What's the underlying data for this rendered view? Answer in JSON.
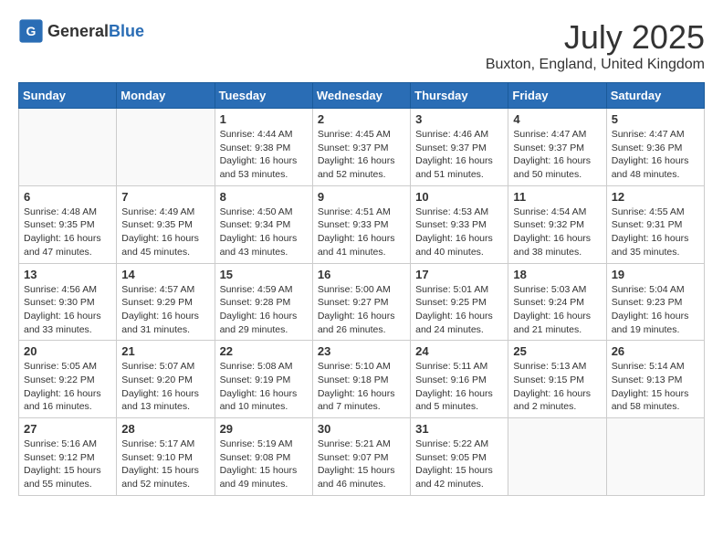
{
  "header": {
    "logo_general": "General",
    "logo_blue": "Blue",
    "month_year": "July 2025",
    "location": "Buxton, England, United Kingdom"
  },
  "days_of_week": [
    "Sunday",
    "Monday",
    "Tuesday",
    "Wednesday",
    "Thursday",
    "Friday",
    "Saturday"
  ],
  "weeks": [
    [
      {
        "day": "",
        "sunrise": "",
        "sunset": "",
        "daylight": ""
      },
      {
        "day": "",
        "sunrise": "",
        "sunset": "",
        "daylight": ""
      },
      {
        "day": "1",
        "sunrise": "Sunrise: 4:44 AM",
        "sunset": "Sunset: 9:38 PM",
        "daylight": "Daylight: 16 hours and 53 minutes."
      },
      {
        "day": "2",
        "sunrise": "Sunrise: 4:45 AM",
        "sunset": "Sunset: 9:37 PM",
        "daylight": "Daylight: 16 hours and 52 minutes."
      },
      {
        "day": "3",
        "sunrise": "Sunrise: 4:46 AM",
        "sunset": "Sunset: 9:37 PM",
        "daylight": "Daylight: 16 hours and 51 minutes."
      },
      {
        "day": "4",
        "sunrise": "Sunrise: 4:47 AM",
        "sunset": "Sunset: 9:37 PM",
        "daylight": "Daylight: 16 hours and 50 minutes."
      },
      {
        "day": "5",
        "sunrise": "Sunrise: 4:47 AM",
        "sunset": "Sunset: 9:36 PM",
        "daylight": "Daylight: 16 hours and 48 minutes."
      }
    ],
    [
      {
        "day": "6",
        "sunrise": "Sunrise: 4:48 AM",
        "sunset": "Sunset: 9:35 PM",
        "daylight": "Daylight: 16 hours and 47 minutes."
      },
      {
        "day": "7",
        "sunrise": "Sunrise: 4:49 AM",
        "sunset": "Sunset: 9:35 PM",
        "daylight": "Daylight: 16 hours and 45 minutes."
      },
      {
        "day": "8",
        "sunrise": "Sunrise: 4:50 AM",
        "sunset": "Sunset: 9:34 PM",
        "daylight": "Daylight: 16 hours and 43 minutes."
      },
      {
        "day": "9",
        "sunrise": "Sunrise: 4:51 AM",
        "sunset": "Sunset: 9:33 PM",
        "daylight": "Daylight: 16 hours and 41 minutes."
      },
      {
        "day": "10",
        "sunrise": "Sunrise: 4:53 AM",
        "sunset": "Sunset: 9:33 PM",
        "daylight": "Daylight: 16 hours and 40 minutes."
      },
      {
        "day": "11",
        "sunrise": "Sunrise: 4:54 AM",
        "sunset": "Sunset: 9:32 PM",
        "daylight": "Daylight: 16 hours and 38 minutes."
      },
      {
        "day": "12",
        "sunrise": "Sunrise: 4:55 AM",
        "sunset": "Sunset: 9:31 PM",
        "daylight": "Daylight: 16 hours and 35 minutes."
      }
    ],
    [
      {
        "day": "13",
        "sunrise": "Sunrise: 4:56 AM",
        "sunset": "Sunset: 9:30 PM",
        "daylight": "Daylight: 16 hours and 33 minutes."
      },
      {
        "day": "14",
        "sunrise": "Sunrise: 4:57 AM",
        "sunset": "Sunset: 9:29 PM",
        "daylight": "Daylight: 16 hours and 31 minutes."
      },
      {
        "day": "15",
        "sunrise": "Sunrise: 4:59 AM",
        "sunset": "Sunset: 9:28 PM",
        "daylight": "Daylight: 16 hours and 29 minutes."
      },
      {
        "day": "16",
        "sunrise": "Sunrise: 5:00 AM",
        "sunset": "Sunset: 9:27 PM",
        "daylight": "Daylight: 16 hours and 26 minutes."
      },
      {
        "day": "17",
        "sunrise": "Sunrise: 5:01 AM",
        "sunset": "Sunset: 9:25 PM",
        "daylight": "Daylight: 16 hours and 24 minutes."
      },
      {
        "day": "18",
        "sunrise": "Sunrise: 5:03 AM",
        "sunset": "Sunset: 9:24 PM",
        "daylight": "Daylight: 16 hours and 21 minutes."
      },
      {
        "day": "19",
        "sunrise": "Sunrise: 5:04 AM",
        "sunset": "Sunset: 9:23 PM",
        "daylight": "Daylight: 16 hours and 19 minutes."
      }
    ],
    [
      {
        "day": "20",
        "sunrise": "Sunrise: 5:05 AM",
        "sunset": "Sunset: 9:22 PM",
        "daylight": "Daylight: 16 hours and 16 minutes."
      },
      {
        "day": "21",
        "sunrise": "Sunrise: 5:07 AM",
        "sunset": "Sunset: 9:20 PM",
        "daylight": "Daylight: 16 hours and 13 minutes."
      },
      {
        "day": "22",
        "sunrise": "Sunrise: 5:08 AM",
        "sunset": "Sunset: 9:19 PM",
        "daylight": "Daylight: 16 hours and 10 minutes."
      },
      {
        "day": "23",
        "sunrise": "Sunrise: 5:10 AM",
        "sunset": "Sunset: 9:18 PM",
        "daylight": "Daylight: 16 hours and 7 minutes."
      },
      {
        "day": "24",
        "sunrise": "Sunrise: 5:11 AM",
        "sunset": "Sunset: 9:16 PM",
        "daylight": "Daylight: 16 hours and 5 minutes."
      },
      {
        "day": "25",
        "sunrise": "Sunrise: 5:13 AM",
        "sunset": "Sunset: 9:15 PM",
        "daylight": "Daylight: 16 hours and 2 minutes."
      },
      {
        "day": "26",
        "sunrise": "Sunrise: 5:14 AM",
        "sunset": "Sunset: 9:13 PM",
        "daylight": "Daylight: 15 hours and 58 minutes."
      }
    ],
    [
      {
        "day": "27",
        "sunrise": "Sunrise: 5:16 AM",
        "sunset": "Sunset: 9:12 PM",
        "daylight": "Daylight: 15 hours and 55 minutes."
      },
      {
        "day": "28",
        "sunrise": "Sunrise: 5:17 AM",
        "sunset": "Sunset: 9:10 PM",
        "daylight": "Daylight: 15 hours and 52 minutes."
      },
      {
        "day": "29",
        "sunrise": "Sunrise: 5:19 AM",
        "sunset": "Sunset: 9:08 PM",
        "daylight": "Daylight: 15 hours and 49 minutes."
      },
      {
        "day": "30",
        "sunrise": "Sunrise: 5:21 AM",
        "sunset": "Sunset: 9:07 PM",
        "daylight": "Daylight: 15 hours and 46 minutes."
      },
      {
        "day": "31",
        "sunrise": "Sunrise: 5:22 AM",
        "sunset": "Sunset: 9:05 PM",
        "daylight": "Daylight: 15 hours and 42 minutes."
      },
      {
        "day": "",
        "sunrise": "",
        "sunset": "",
        "daylight": ""
      },
      {
        "day": "",
        "sunrise": "",
        "sunset": "",
        "daylight": ""
      }
    ]
  ]
}
